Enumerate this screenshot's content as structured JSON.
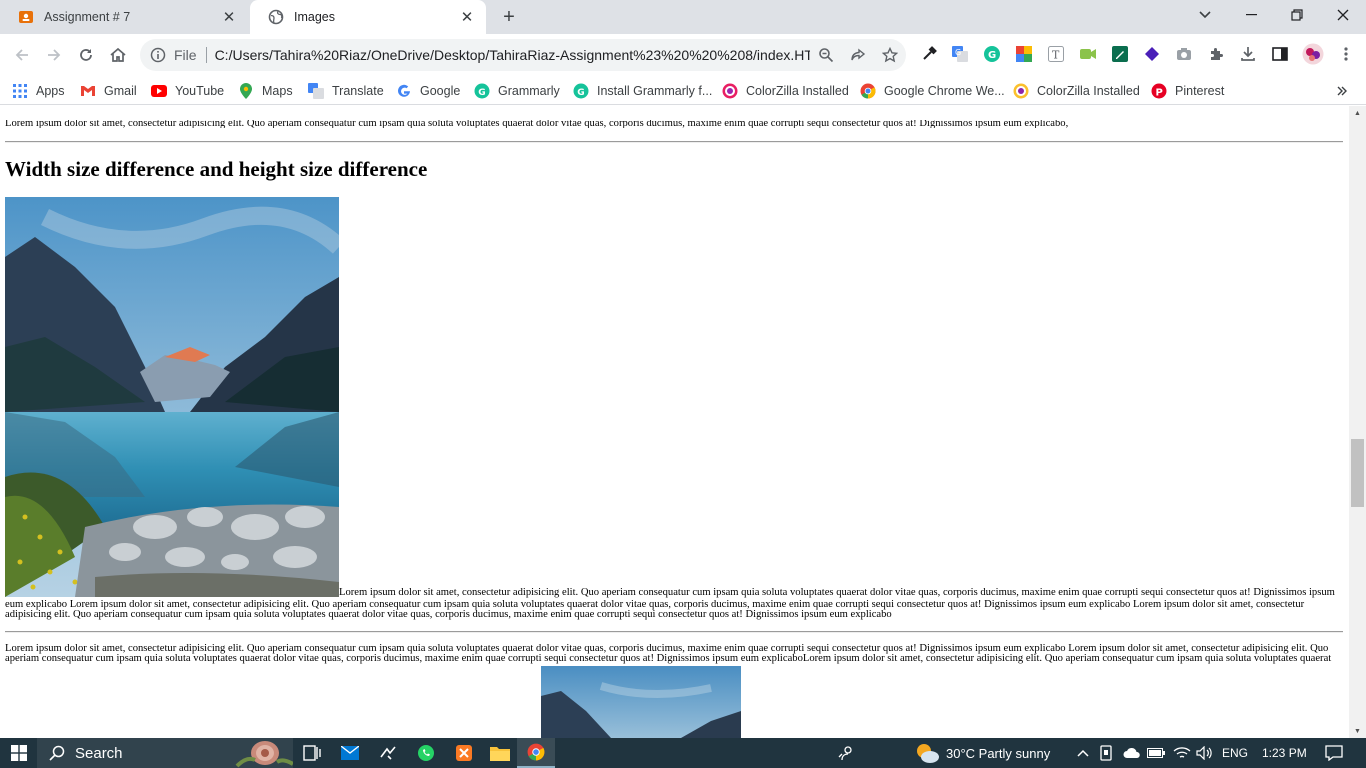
{
  "browser": {
    "tabs": [
      {
        "title": "Assignment # 7",
        "icon": "classroom-icon",
        "active": false
      },
      {
        "title": "Images",
        "icon": "globe-icon",
        "active": true
      }
    ],
    "address": {
      "scheme": "File",
      "url": "C:/Users/Tahira%20Riaz/OneDrive/Desktop/TahiraRiaz-Assignment%23%20%20%208/index.HT..."
    },
    "bookmarks": [
      {
        "label": "Apps",
        "icon": "apps-grid-icon"
      },
      {
        "label": "Gmail",
        "icon": "gmail-icon"
      },
      {
        "label": "YouTube",
        "icon": "youtube-icon"
      },
      {
        "label": "Maps",
        "icon": "maps-icon"
      },
      {
        "label": "Translate",
        "icon": "translate-icon"
      },
      {
        "label": "Google",
        "icon": "google-icon"
      },
      {
        "label": "Grammarly",
        "icon": "grammarly-icon"
      },
      {
        "label": "Install Grammarly f...",
        "icon": "grammarly-icon"
      },
      {
        "label": "ColorZilla Installed",
        "icon": "colorzilla-icon"
      },
      {
        "label": "Google Chrome We...",
        "icon": "chrome-icon"
      },
      {
        "label": "ColorZilla Installed",
        "icon": "colorzilla-icon"
      },
      {
        "label": "Pinterest",
        "icon": "pinterest-icon"
      }
    ]
  },
  "page": {
    "top_paragraph": "Lorem ipsum dolor sit amet, consectetur adipisicing elit. Quo aperiam consequatur cum ipsam quia soluta voluptates quaerat dolor vitae quas, corporis ducimus, maxime enim quae corrupti sequi consectetur quos at! Dignissimos ipsum eum explicabo,",
    "heading": "Width size difference and height size difference",
    "paragraph_line1": "Lorem ipsum dolor sit amet, consectetur adipisicing elit. Quo aperiam consequatur cum ipsam quia soluta voluptates quaerat dolor vitae quas, corporis ducimus, maxime enim quae corrupti sequi consectetur quos at! Dignissimos ipsum",
    "paragraph_line2": "eum explicabo Lorem ipsum dolor sit amet, consectetur adipisicing elit. Quo aperiam consequatur cum ipsam quia soluta voluptates quaerat dolor vitae quas, corporis ducimus, maxime enim quae corrupti sequi consectetur quos at! Dignissimos ipsum eum explicabo Lorem ipsum dolor sit amet, consectetur",
    "paragraph_line3": "adipisicing elit. Quo aperiam consequatur cum ipsam quia soluta voluptates quaerat dolor vitae quas, corporis ducimus, maxime enim quae corrupti sequi consectetur quos at! Dignissimos ipsum eum explicabo",
    "lower_line1": "Lorem ipsum dolor sit amet, consectetur adipisicing elit. Quo aperiam consequatur cum ipsam quia soluta voluptates quaerat dolor vitae quas, corporis ducimus, maxime enim quae corrupti sequi consectetur quos at! Dignissimos ipsum eum explicabo Lorem ipsum dolor sit amet, consectetur adipisicing elit. Quo",
    "lower_line2": "aperiam consequatur cum ipsam quia soluta voluptates quaerat dolor vitae quas, corporis ducimus, maxime enim quae corrupti sequi consectetur quos at! Dignissimos ipsum eum explicaboLorem ipsum dolor sit amet, consectetur adipisicing elit. Quo aperiam consequatur cum ipsam quia soluta voluptates quaerat"
  },
  "taskbar": {
    "search_label": "Search",
    "weather": "30°C  Partly sunny",
    "language": "ENG",
    "time": "1:23 PM"
  },
  "colors": {
    "tabstrip": "#dee1e6",
    "taskbar": "#20343f",
    "accent": "#1a73e8"
  }
}
